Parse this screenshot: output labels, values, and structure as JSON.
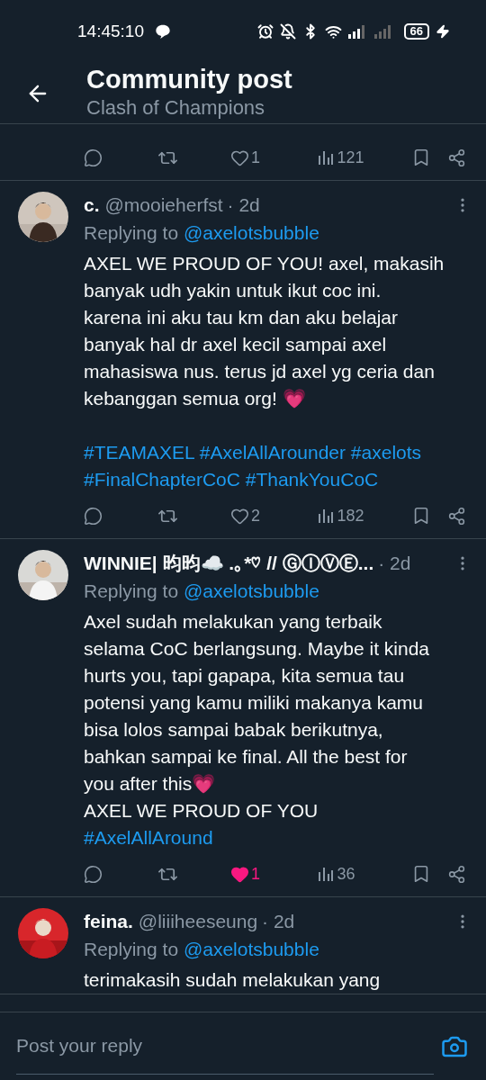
{
  "status_bar": {
    "time": "14:45:10",
    "battery": "66"
  },
  "header": {
    "title": "Community post",
    "subtitle": "Clash of Champions"
  },
  "top_actions": {
    "liked": false,
    "like_count": "1",
    "views": "121"
  },
  "replies": [
    {
      "name": "c.",
      "handle": "@mooieherfst",
      "time": "· 2d",
      "replying_label": "Replying to",
      "replying_to": "@axelotsbubble",
      "body": [
        {
          "kind": "text",
          "text": "AXEL WE PROUD OF YOU! axel, makasih"
        },
        {
          "kind": "text",
          "text": "banyak udh yakin untuk ikut coc ini."
        },
        {
          "kind": "text",
          "text": "karena ini aku tau km dan aku belajar"
        },
        {
          "kind": "text",
          "text": "banyak hal dr axel kecil sampai axel"
        },
        {
          "kind": "text",
          "text": "mahasiswa nus. terus jd axel yg ceria dan"
        },
        {
          "kind": "text",
          "text": "kebanggan semua org! 💗"
        },
        {
          "kind": "blank"
        },
        {
          "kind": "hashtags",
          "text": "#TEAMAXEL #AxelAllArounder #axelots"
        },
        {
          "kind": "hashtags",
          "text": "#FinalChapterCoC #ThankYouCoC"
        }
      ],
      "actions": {
        "liked": false,
        "like_count": "2",
        "views": "182"
      }
    },
    {
      "name": "WINNIE| 昀昀☁️ .｡*♡ // ⒼⒾⓋⒺ...",
      "time": "· 2d",
      "replying_label": "Replying to",
      "replying_to": "@axelotsbubble",
      "body": [
        {
          "kind": "text",
          "text": "Axel sudah melakukan yang terbaik"
        },
        {
          "kind": "text",
          "text": "selama CoC berlangsung. Maybe it kinda"
        },
        {
          "kind": "text",
          "text": "hurts you, tapi gapapa, kita semua tau"
        },
        {
          "kind": "text",
          "text": "potensi yang kamu miliki makanya kamu"
        },
        {
          "kind": "text",
          "text": "bisa lolos sampai babak berikutnya,"
        },
        {
          "kind": "text",
          "text": "bahkan sampai ke final. All the best for"
        },
        {
          "kind": "text",
          "text": "you after this💗"
        },
        {
          "kind": "text",
          "text": "AXEL WE PROUD OF YOU"
        },
        {
          "kind": "hashtags",
          "text": "#AxelAllAround"
        }
      ],
      "actions": {
        "liked": true,
        "like_count": "1",
        "views": "36"
      }
    },
    {
      "name": "feina.",
      "handle": "@liiiheeseung",
      "time": "· 2d",
      "replying_label": "Replying to",
      "replying_to": "@axelotsbubble",
      "body": [
        {
          "kind": "text",
          "text": "terimakasih sudah melakukan yang"
        }
      ]
    }
  ],
  "reply_bar": {
    "placeholder": "Post your reply"
  }
}
